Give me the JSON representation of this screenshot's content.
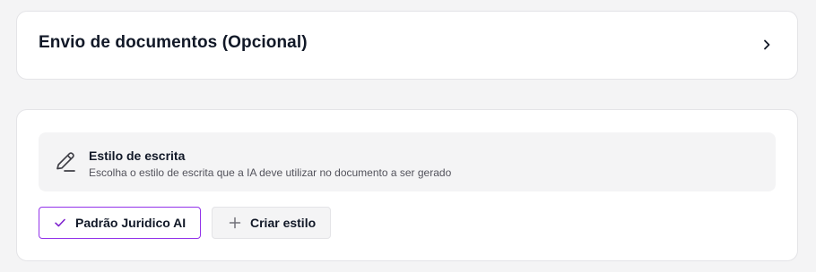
{
  "documents_section": {
    "title": "Envio de documentos (Opcional)",
    "expand_icon": "chevron-right-icon"
  },
  "writing_style": {
    "icon": "pencil-icon",
    "title": "Estilo de escrita",
    "description": "Escolha o estilo de escrita que a IA deve utilizar no documento a ser gerado",
    "options": [
      {
        "label": "Padrão Juridico AI",
        "selected": true,
        "icon": "check-icon"
      }
    ],
    "create_button": {
      "label": "Criar estilo",
      "icon": "plus-icon"
    }
  },
  "colors": {
    "page_bg": "#f4f4f5",
    "card_bg": "#ffffff",
    "accent": "#9333ea",
    "text": "#111827",
    "muted": "#52525b"
  }
}
